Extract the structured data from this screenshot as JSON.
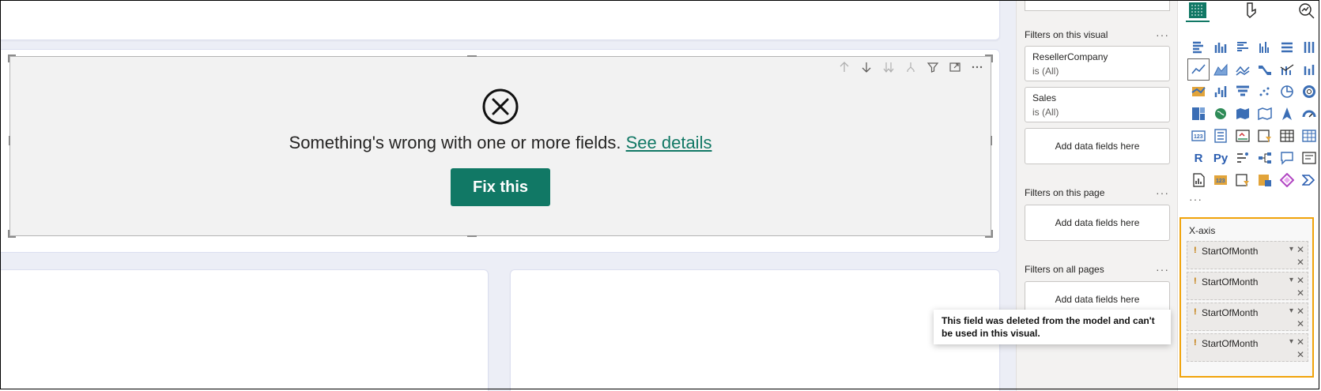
{
  "visual": {
    "error_message": "Something's wrong with one or more fields.",
    "error_link": "See details",
    "fix_button": "Fix this",
    "toolbar_icons": [
      "arrow-up-icon",
      "arrow-down-icon",
      "double-arrow-down-icon",
      "fork-icon",
      "filter-icon",
      "focus-mode-icon",
      "more-options-icon"
    ]
  },
  "filters": {
    "on_this_visual_title": "Filters on this visual",
    "visual_filters": [
      {
        "name": "ResellerCompany",
        "state": "is (All)"
      },
      {
        "name": "Sales",
        "state": "is (All)"
      }
    ],
    "add_fields": "Add data fields here",
    "on_this_page_title": "Filters on this page",
    "on_all_pages_title": "Filters on all pages",
    "more": "···"
  },
  "viz_pane": {
    "more": "···",
    "text_icons": {
      "r": "R",
      "py": "Py"
    },
    "x_axis": {
      "label": "X-axis",
      "fields": [
        "StartOfMonth",
        "StartOfMonth",
        "StartOfMonth",
        "StartOfMonth"
      ],
      "warning_glyph": "!"
    }
  },
  "tooltip": {
    "text": "This field was deleted from the model and can't be used in this visual."
  },
  "colors": {
    "accent": "#117865",
    "highlight": "#f0a30a",
    "warning": "#c27800"
  }
}
